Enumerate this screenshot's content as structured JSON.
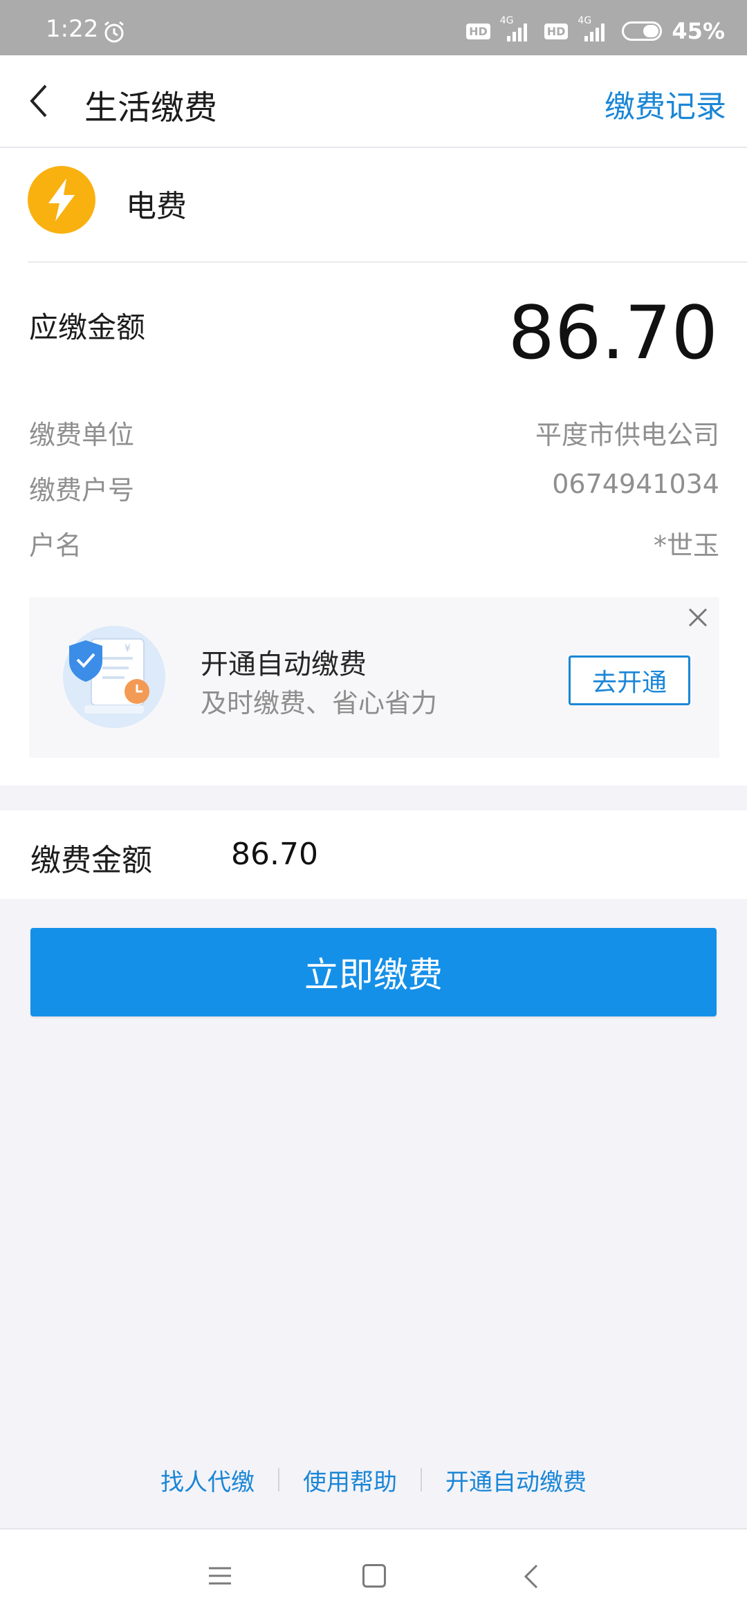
{
  "status_bar": {
    "time": "1:22",
    "hd1": "HD",
    "net1": "4G",
    "hd2": "HD",
    "net2": "4G",
    "battery": "45%",
    "battery_level": 0.45
  },
  "navbar": {
    "title": "生活缴费",
    "record_label": "缴费记录"
  },
  "bill": {
    "name": "电费",
    "amount_label": "应缴金额",
    "amount": "86.70",
    "info": [
      {
        "key": "缴费单位",
        "value": "平度市供电公司"
      },
      {
        "key": "缴费户号",
        "value": "0674941034"
      },
      {
        "key": "户名",
        "value": "*世玉"
      }
    ]
  },
  "promo": {
    "title": "开通自动缴费",
    "subtitle": "及时缴费、省心省力",
    "button": "去开通",
    "illus_currency": "¥"
  },
  "payment": {
    "label": "缴费金额",
    "value": "86.70",
    "button": "立即缴费"
  },
  "footer": {
    "links": [
      "找人代缴",
      "使用帮助",
      "开通自动缴费"
    ]
  },
  "colors": {
    "accent": "#1a86d6",
    "pay_button": "#1590e8",
    "bolt_circle": "#f9b110"
  }
}
